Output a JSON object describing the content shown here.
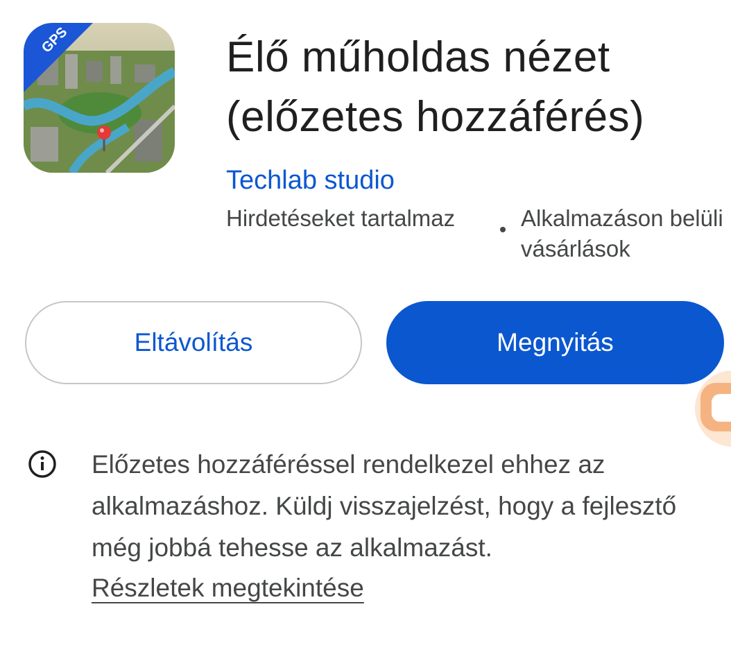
{
  "app": {
    "title": "Élő műholdas nézet (előzetes hozzáférés)",
    "developer": "Techlab studio",
    "contains_ads": "Hirdetéseket tartalmaz",
    "in_app_purchases": "Alkalmazáson belüli vásárlások",
    "icon_badge": "GPS"
  },
  "buttons": {
    "uninstall_label": "Eltávolítás",
    "open_label": "Megnyitás"
  },
  "info": {
    "message": "Előzetes hozzáféréssel rendelkezel ehhez az alkalmazáshoz. Küldj visszajelzést, hogy a fejlesztő még jobbá tehesse az alkalmazást.",
    "details_link": "Részletek megtekintése"
  },
  "colors": {
    "accent": "#0b57d0",
    "text_primary": "#1f1f1f",
    "text_secondary": "#444746",
    "outline": "#c4c7c5",
    "floating_handle": "#f6b382"
  },
  "icons": {
    "info": "info-circle-icon",
    "app": "satellite-map-app-icon",
    "map_pin": "map-pin-icon"
  }
}
